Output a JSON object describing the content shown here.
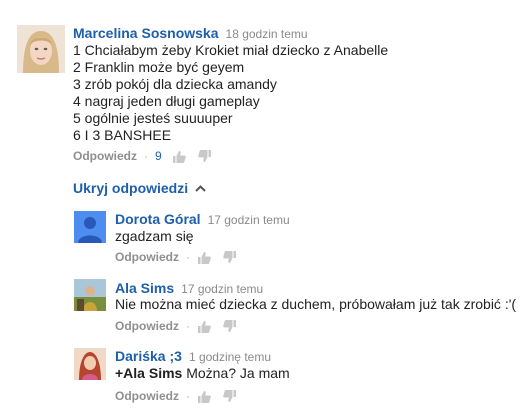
{
  "top_comment": {
    "author": "Marcelina Sosnowska",
    "time": "18 godzin temu",
    "lines": [
      "1 Chciałabym żeby Krokiet miał dziecko z Anabelle",
      "2 Franklin może być geyem",
      "3 zrób pokój dla dziecka amandy",
      "4 nagraj jeden długi gameplay",
      "5 ogólnie jesteś suuuuper",
      "6 I 3 BANSHEE"
    ],
    "reply_label": "Odpowiedz",
    "like_count": "9"
  },
  "toggle_replies_label": "Ukryj odpowiedzi",
  "replies": [
    {
      "author": "Dorota Góral",
      "time": "17 godzin temu",
      "text": "zgadzam się",
      "reply_label": "Odpowiedz"
    },
    {
      "author": "Ala Sims",
      "time": "17 godzin temu",
      "text": "Nie można mieć dziecka z duchem, próbowałam już tak zrobić :'(",
      "reply_label": "Odpowiedz"
    },
    {
      "author": "Dariśka ;3",
      "time": "1 godzinę temu",
      "mention": "+Ala Sims",
      "text": " Można? Ja mam",
      "reply_label": "Odpowiedz"
    }
  ],
  "colors": {
    "link": "#1e5fab",
    "meta": "#8a8a8a",
    "icon": "#c8c8c8"
  },
  "icons": [
    "thumb-up-icon",
    "thumb-down-icon",
    "chevron-up-icon",
    "default-avatar-icon"
  ]
}
